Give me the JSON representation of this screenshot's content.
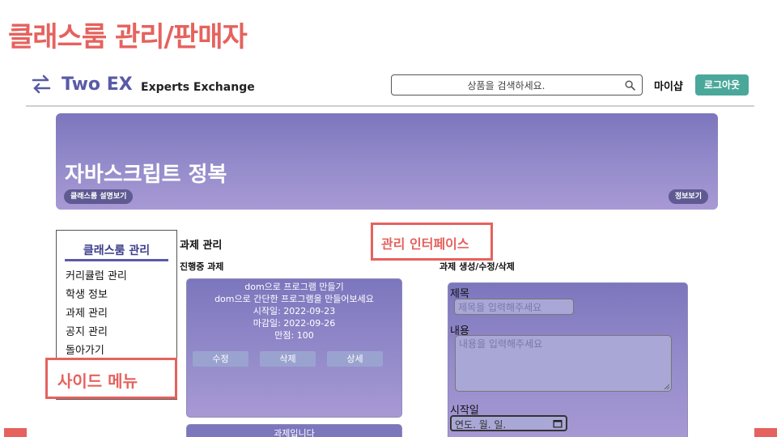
{
  "slide": {
    "title": "클래스룸 관리/판매자"
  },
  "header": {
    "brand": "Two EX",
    "brand_sub": "Experts Exchange",
    "search_placeholder": "상품을 검색하세요.",
    "mypage": "마이샵",
    "logout": "로그아웃"
  },
  "banner": {
    "title": "자바스크립트 정복",
    "left_pill": "클래스룸 설명보기",
    "right_pill": "정보보기"
  },
  "sidebar": {
    "heading": "클래스룸 관리",
    "items": [
      "커리큘럼 관리",
      "학생 정보",
      "과제 관리",
      "공지 관리",
      "돌아가기"
    ]
  },
  "callouts": {
    "side_menu": "사이드 메뉴",
    "admin_interface": "관리 인터페이스"
  },
  "main": {
    "section_title": "과제 관리",
    "ongoing_title": "진행중 과제",
    "manage_title": "과제 생성/수정/삭제",
    "assignment": {
      "lines": [
        "dom으로 프로그램 만들기",
        "dom으로 간단한 프로그램을 만들어보세요",
        "시작일: 2022-09-23",
        "마감일: 2022-09-26",
        "만점: 100"
      ],
      "edit": "수정",
      "delete": "삭제",
      "detail": "상세"
    },
    "assignment2_title": "과제입니다",
    "form": {
      "title_label": "제목",
      "title_placeholder": "제목을 입력해주세요",
      "content_label": "내용",
      "content_placeholder": "내용을 입력해주세요",
      "start_label": "시작일",
      "date_placeholder": "연도. 월. 일."
    }
  },
  "colors": {
    "accent": "#e5625e",
    "brand": "#5a5aa8",
    "logout": "#4aa89a",
    "banner": "#8f88c8"
  }
}
